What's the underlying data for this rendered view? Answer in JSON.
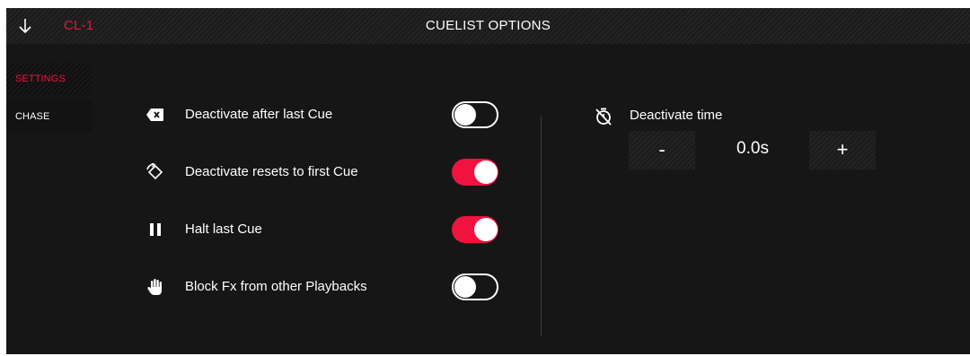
{
  "header": {
    "back_icon": "arrow-down-icon",
    "cuelist_id": "CL-1",
    "title": "CUELIST OPTIONS"
  },
  "tabs": [
    {
      "label": "SETTINGS",
      "active": true
    },
    {
      "label": "CHASE",
      "active": false
    }
  ],
  "options": [
    {
      "icon": "clear-tag-icon",
      "label": "Deactivate after last Cue",
      "enabled": false
    },
    {
      "icon": "reset-rotate-icon",
      "label": "Deactivate resets to first Cue",
      "enabled": true
    },
    {
      "icon": "pause-icon",
      "label": "Halt last Cue",
      "enabled": true
    },
    {
      "icon": "hand-icon",
      "label": "Block Fx from other Playbacks",
      "enabled": false
    }
  ],
  "deactivate_time": {
    "icon": "timer-off-icon",
    "label": "Deactivate time",
    "decrement_label": "-",
    "value": "0.0s",
    "increment_label": "+"
  },
  "colors": {
    "accent": "#f2123f",
    "accent_text": "#e6153a",
    "background": "#161616",
    "text": "#ffffff"
  }
}
